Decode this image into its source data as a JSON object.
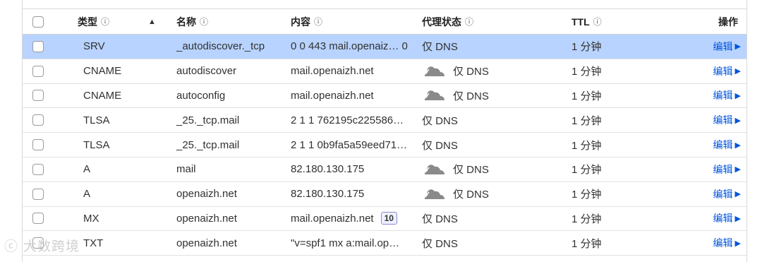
{
  "header": {
    "type": "类型",
    "name": "名称",
    "content": "内容",
    "proxy": "代理状态",
    "ttl": "TTL",
    "actions": "操作",
    "info_icon": "ⓘ",
    "sort_indicator": "▲"
  },
  "rows": [
    {
      "type": "SRV",
      "name": "_autodiscover._tcp",
      "content": "0 0 443 mail.openaiz…",
      "content_tail": "0",
      "proxy": "仅 DNS",
      "cloud": false,
      "ttl": "1 分钟",
      "action": "编辑",
      "selected": true
    },
    {
      "type": "CNAME",
      "name": "autodiscover",
      "content": "mail.openaizh.net",
      "proxy": "仅 DNS",
      "cloud": true,
      "ttl": "1 分钟",
      "action": "编辑"
    },
    {
      "type": "CNAME",
      "name": "autoconfig",
      "content": "mail.openaizh.net",
      "proxy": "仅 DNS",
      "cloud": true,
      "ttl": "1 分钟",
      "action": "编辑"
    },
    {
      "type": "TLSA",
      "name": "_25._tcp.mail",
      "content": "2 1 1 762195c225586…",
      "proxy": "仅 DNS",
      "cloud": false,
      "ttl": "1 分钟",
      "action": "编辑"
    },
    {
      "type": "TLSA",
      "name": "_25._tcp.mail",
      "content": "2 1 1 0b9fa5a59eed71…",
      "proxy": "仅 DNS",
      "cloud": false,
      "ttl": "1 分钟",
      "action": "编辑"
    },
    {
      "type": "A",
      "name": "mail",
      "content": "82.180.130.175",
      "proxy": "仅 DNS",
      "cloud": true,
      "ttl": "1 分钟",
      "action": "编辑"
    },
    {
      "type": "A",
      "name": "openaizh.net",
      "content": "82.180.130.175",
      "proxy": "仅 DNS",
      "cloud": true,
      "ttl": "1 分钟",
      "action": "编辑"
    },
    {
      "type": "MX",
      "name": "openaizh.net",
      "content": "mail.openaizh.net",
      "priority": "10",
      "proxy": "仅 DNS",
      "cloud": false,
      "ttl": "1 分钟",
      "action": "编辑"
    },
    {
      "type": "TXT",
      "name": "openaizh.net",
      "content": "\"v=spf1 mx a:mail.op…",
      "proxy": "仅 DNS",
      "cloud": false,
      "ttl": "1 分钟",
      "action": "编辑"
    }
  ],
  "icons": {
    "proxy_status": "cloud-gray-icon",
    "action_arrow": "triangle-right-icon"
  },
  "colors": {
    "selected_row": "#b8d3ff",
    "link": "#0055dd",
    "cloud_gray": "#8a8a8a"
  },
  "watermark": "ⓒ 大数跨境"
}
